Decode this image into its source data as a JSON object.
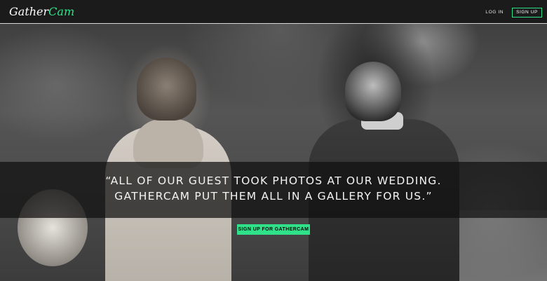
{
  "brand": {
    "logo_prefix": "Gather",
    "logo_suffix": "Cam",
    "accent_color": "#2fe28a"
  },
  "nav": {
    "login_label": "LOG IN",
    "signup_label": "SIGN UP"
  },
  "hero": {
    "quote_line1": "“ALL OF OUR GUEST TOOK PHOTOS AT OUR WEDDING.",
    "quote_line2": "GATHERCAM PUT THEM ALL IN A GALLERY FOR US.”",
    "cta_label": "SIGN UP FOR GATHERCAM"
  }
}
